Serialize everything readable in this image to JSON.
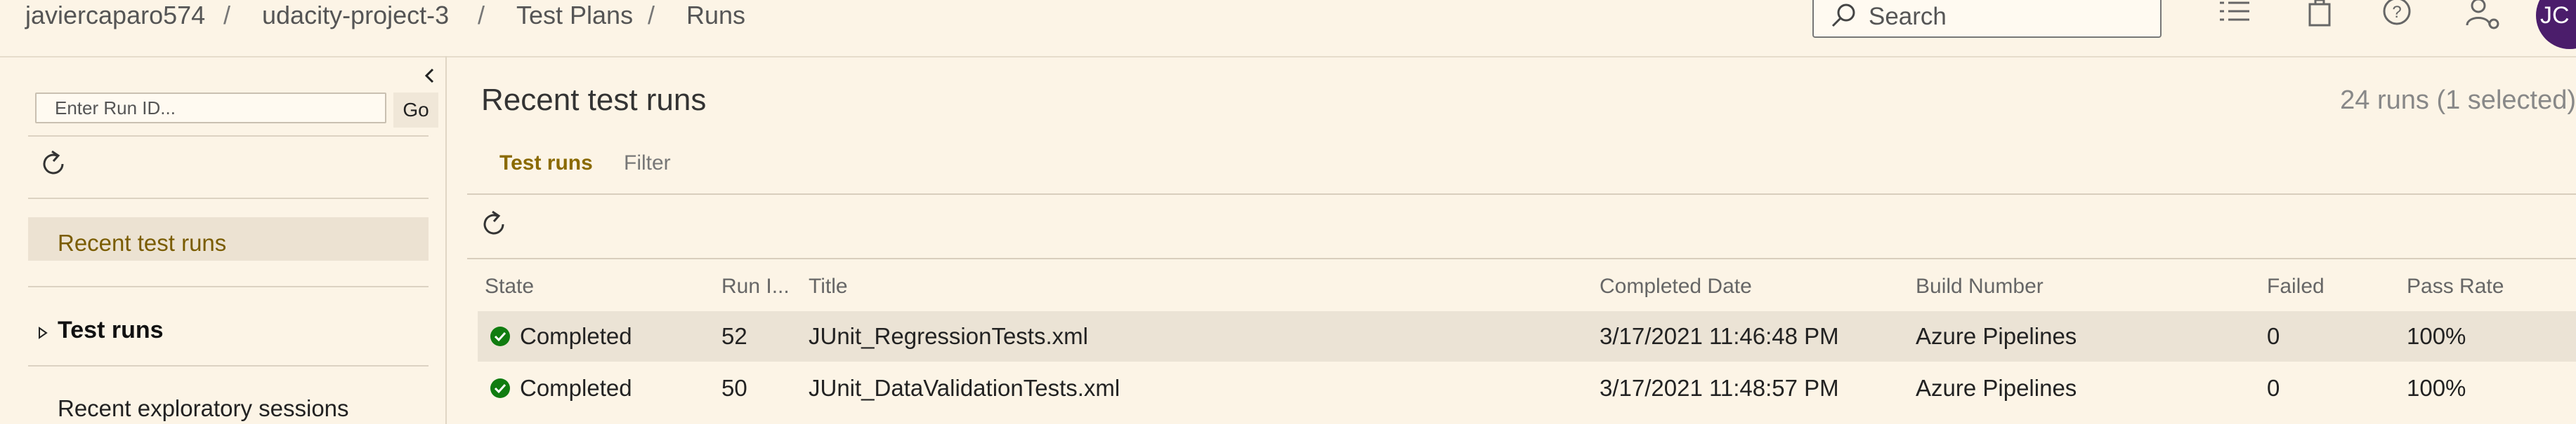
{
  "breadcrumb": [
    "javiercaparo574",
    "udacity-project-3",
    "Test Plans",
    "Runs"
  ],
  "breadcrumb_separator": "/",
  "search": {
    "placeholder": "Search"
  },
  "header_icons": [
    "list-icon",
    "shopping-bag-icon",
    "help-icon",
    "user-settings-icon"
  ],
  "user": {
    "initials": "JC",
    "avatar_color": "#4b1d6b"
  },
  "left_pane": {
    "collapse_icon": "chevron-left-icon",
    "run_id_placeholder": "Enter Run ID...",
    "go_label": "Go",
    "nav": {
      "recent_test_runs": "Recent test runs",
      "test_runs": "Test runs",
      "recent_exploratory_sessions": "Recent exploratory sessions"
    }
  },
  "main": {
    "title": "Recent test runs",
    "runs_count": "24 runs (1 selected)",
    "tabs": [
      {
        "label": "Test runs",
        "active": true
      },
      {
        "label": "Filter",
        "active": false
      }
    ],
    "table": {
      "columns": [
        "State",
        "Run I...",
        "Title",
        "Completed Date",
        "Build Number",
        "Failed",
        "Pass Rate"
      ],
      "rows": [
        {
          "state": "Completed",
          "run_id": "52",
          "title": "JUnit_RegressionTests.xml",
          "completed_date": "3/17/2021 11:46:48 PM",
          "build_number": "Azure Pipelines",
          "failed": "0",
          "pass_rate": "100%",
          "selected": true
        },
        {
          "state": "Completed",
          "run_id": "50",
          "title": "JUnit_DataValidationTests.xml",
          "completed_date": "3/17/2021 11:48:57 PM",
          "build_number": "Azure Pipelines",
          "failed": "0",
          "pass_rate": "100%",
          "selected": false
        }
      ]
    }
  },
  "colors": {
    "background": "#fcf4e6",
    "accent_tab": "#8a6a00",
    "status_success": "#107c10",
    "selected_row": "#ebe3d5"
  }
}
